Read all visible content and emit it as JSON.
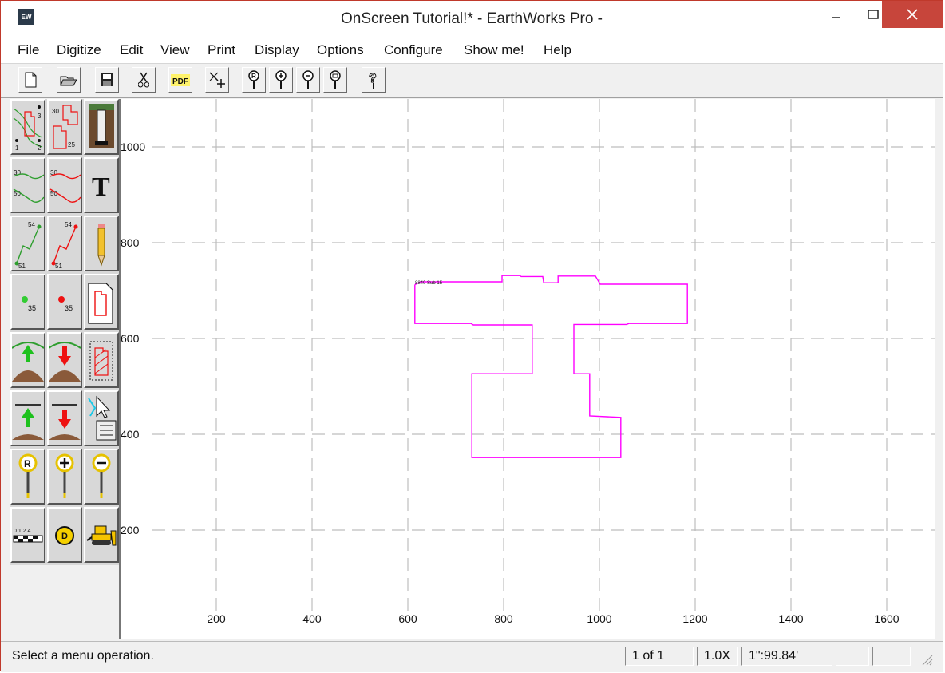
{
  "window": {
    "title": "OnScreen Tutorial!* - EarthWorks Pro -",
    "icon_label": "EW"
  },
  "menu": [
    "File",
    "Digitize",
    "Edit",
    "View",
    "Print",
    "Display",
    "Options",
    "Configure",
    "Show me!",
    "Help"
  ],
  "toolbar": {
    "icons": [
      "new-file-icon",
      "open-folder-icon",
      "save-disk-icon",
      "cut-scissors-icon",
      "pdf-icon",
      "crosshair-cursor-icon",
      "zoom-reset-icon",
      "zoom-in-icon",
      "zoom-out-icon",
      "zoom-window-icon",
      "help-question-icon"
    ],
    "pdf_label": "PDF"
  },
  "palette": {
    "icons": [
      "contour-outline-icon",
      "numbered-outline-icon",
      "borehole-icon",
      "existing-contour-icon",
      "proposed-contour-icon",
      "text-icon",
      "existing-spot-elevation-icon",
      "proposed-spot-elevation-icon",
      "pencil-icon",
      "existing-point-icon",
      "proposed-point-icon",
      "region-outline-icon",
      "fill-mound-icon",
      "cut-mound-icon",
      "hatched-region-icon",
      "raise-elevation-icon",
      "lower-elevation-icon",
      "select-pointer-icon",
      "reset-zoom-pin-icon",
      "zoom-in-pin-icon",
      "zoom-out-pin-icon",
      "scale-ruler-icon",
      "distance-tape-icon",
      "bulldozer-icon"
    ],
    "labels": {
      "outline_top": "3",
      "outline_bl": "1",
      "outline_br": "2",
      "num_top": "30",
      "num_bottom": "25",
      "contour_top": "30",
      "contour_bottom": "50",
      "spot_top": "54",
      "spot_bottom": "51",
      "point_value": "35",
      "text_glyph": "T",
      "scale_ticks": "0 1 2 4"
    }
  },
  "plot": {
    "y_ticks": [
      "1000",
      "800",
      "600",
      "400",
      "200"
    ],
    "x_ticks": [
      "200",
      "400",
      "600",
      "800",
      "1000",
      "1200",
      "1400",
      "1600"
    ],
    "polygon_label": "8840 Sub 15",
    "outline_color": "#ff00ff"
  },
  "chart_data": {
    "type": "scatter",
    "title": "",
    "xlabel": "",
    "ylabel": "",
    "xlim": [
      0,
      1670
    ],
    "ylim": [
      0,
      1100
    ],
    "grid": true,
    "x_ticks": [
      200,
      400,
      600,
      800,
      1000,
      1200,
      1400,
      1600
    ],
    "y_ticks": [
      200,
      400,
      600,
      800,
      1000
    ],
    "series": [
      {
        "name": "",
        "values": [
          [
            613,
            714
          ],
          [
            625,
            720
          ],
          [
            795,
            720
          ],
          [
            795,
            733
          ],
          [
            832,
            733
          ],
          [
            835,
            731
          ],
          [
            880,
            731
          ],
          [
            882,
            718
          ],
          [
            912,
            718
          ],
          [
            912,
            732
          ],
          [
            990,
            732
          ],
          [
            1000,
            715
          ],
          [
            1182,
            715
          ],
          [
            1182,
            633
          ],
          [
            1060,
            633
          ],
          [
            1055,
            631
          ],
          [
            945,
            631
          ],
          [
            945,
            528
          ],
          [
            978,
            528
          ],
          [
            978,
            440
          ],
          [
            1043,
            437
          ],
          [
            1043,
            353
          ],
          [
            732,
            353
          ],
          [
            732,
            528
          ],
          [
            858,
            528
          ],
          [
            858,
            630
          ],
          [
            735,
            630
          ],
          [
            730,
            633
          ],
          [
            613,
            633
          ],
          [
            613,
            714
          ]
        ]
      }
    ],
    "annotations": [
      {
        "text": "8840 Sub 15",
        "x": 620,
        "y": 718
      }
    ]
  },
  "status": {
    "message": "Select a menu operation.",
    "page": "1 of 1",
    "zoom": "1.0X",
    "scale": "1\":99.84'",
    "cell4": "",
    "cell5": ""
  }
}
